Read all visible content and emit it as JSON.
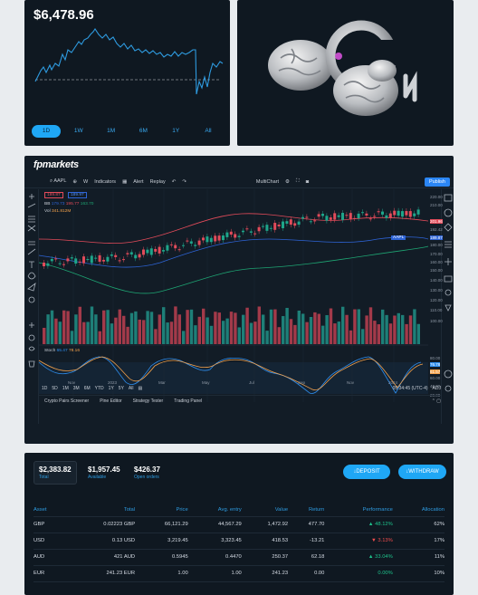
{
  "wallet": {
    "balance": "$6,478.96",
    "ranges": [
      "1D",
      "1W",
      "1M",
      "6M",
      "1Y",
      "All"
    ],
    "active_range": "1D"
  },
  "trading": {
    "brand": "fpmarkets",
    "symbol": "AAPL",
    "toolbar": {
      "interval": "W",
      "indicators": "Indicators",
      "alert": "Alert",
      "replay": "Replay",
      "layout": "MultiChart",
      "publish": "Publish"
    },
    "price_tags": {
      "bid": "189.87",
      "ask": "189.97"
    },
    "bb_legend": {
      "label": "BB",
      "v1": "179.73",
      "v2": "195.77",
      "v3": "163.70"
    },
    "vol_legend": {
      "label": "Vol",
      "v1": "341.812M"
    },
    "stoch_legend": {
      "label": "Stoch",
      "v1": "65.47",
      "v2": "78.16"
    },
    "price_ticks": [
      "220.00",
      "210.00",
      "201.96",
      "192.42",
      "189.87",
      "180.00",
      "170.00",
      "160.00",
      "150.00",
      "140.00",
      "130.00",
      "120.00",
      "110.00",
      "100.00"
    ],
    "stoch_ticks": [
      "80.00",
      "76.78",
      "61.57",
      "60.00",
      "40.00",
      "20.00"
    ],
    "x_ticks": [
      "Nov",
      "2023",
      "Mar",
      "May",
      "Jul",
      "Sep",
      "Nov",
      "2024"
    ],
    "timeframes": [
      "1D",
      "5D",
      "1M",
      "3M",
      "6M",
      "YTD",
      "1Y",
      "5Y",
      "All"
    ],
    "clock": "05:34:45 (UTC-4)",
    "adj": "ADJ",
    "bottom_tabs": [
      "Crypto Pairs Screener",
      "Pine Editor",
      "Strategy Tester",
      "Trading Panel"
    ]
  },
  "portfolio": {
    "total": {
      "value": "$2,383.82",
      "label": "Total"
    },
    "available": {
      "value": "$1,957.45",
      "label": "Available"
    },
    "open": {
      "value": "$426.37",
      "label": "Open orders"
    },
    "deposit": "↓DEPOSIT",
    "withdraw": "↓WITHDRAW",
    "columns": [
      "Asset",
      "Total",
      "Price",
      "Avg. entry",
      "Value",
      "Return",
      "Performance",
      "Allocation"
    ],
    "rows": [
      {
        "asset": "GBP",
        "total": "0.02223 GBP",
        "price": "66,121.29",
        "avg": "44,567.29",
        "value": "1,472.92",
        "ret": "477.70",
        "perf": "▲ 48.12%",
        "perf_dir": "up",
        "alloc": "62%"
      },
      {
        "asset": "USD",
        "total": "0.13 USD",
        "price": "3,219.45",
        "avg": "3,323.45",
        "value": "418.53",
        "ret": "-13.21",
        "perf": "▼ 3.13%",
        "perf_dir": "down",
        "alloc": "17%"
      },
      {
        "asset": "AUD",
        "total": "421 AUD",
        "price": "0.5945",
        "avg": "0.4470",
        "value": "250.37",
        "ret": "62.18",
        "perf": "▲ 33.04%",
        "perf_dir": "up",
        "alloc": "11%"
      },
      {
        "asset": "EUR",
        "total": "241.23 EUR",
        "price": "1.00",
        "avg": "1.00",
        "value": "241.23",
        "ret": "0.00",
        "perf": "0.00%",
        "perf_dir": "zero",
        "alloc": "10%"
      }
    ]
  }
}
